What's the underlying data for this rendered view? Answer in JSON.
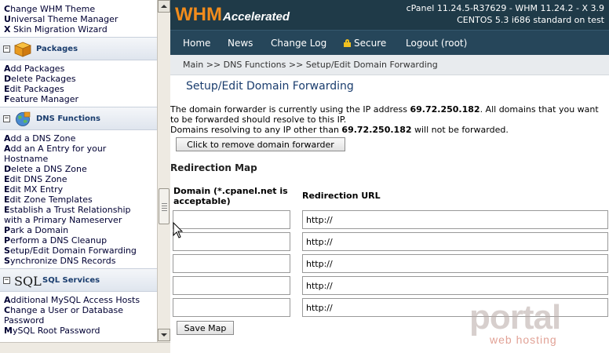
{
  "sidebar": {
    "top_links": [
      {
        "first": "C",
        "rest": "hange WHM Theme"
      },
      {
        "first": "U",
        "rest": "niversal Theme Manager"
      },
      {
        "first": "X",
        "rest": " Skin Migration Wizard"
      }
    ],
    "sections": [
      {
        "title": "Packages",
        "icon": "package-icon",
        "items": [
          {
            "first": "A",
            "rest": "dd Packages"
          },
          {
            "first": "D",
            "rest": "elete Packages"
          },
          {
            "first": "E",
            "rest": "dit Packages"
          },
          {
            "first": "F",
            "rest": "eature Manager"
          }
        ]
      },
      {
        "title": "DNS Functions",
        "icon": "globe-icon",
        "items": [
          {
            "first": "A",
            "rest": "dd a DNS Zone"
          },
          {
            "first": "A",
            "rest": "dd an A Entry for your Hostname"
          },
          {
            "first": "D",
            "rest": "elete a DNS Zone"
          },
          {
            "first": "E",
            "rest": "dit DNS Zone"
          },
          {
            "first": "E",
            "rest": "dit MX Entry"
          },
          {
            "first": "E",
            "rest": "dit Zone Templates"
          },
          {
            "first": "E",
            "rest": "stablish a Trust Relationship with a Primary Nameserver"
          },
          {
            "first": "P",
            "rest": "ark a Domain"
          },
          {
            "first": "P",
            "rest": "erform a DNS Cleanup"
          },
          {
            "first": "S",
            "rest": "etup/Edit Domain Forwarding"
          },
          {
            "first": "S",
            "rest": "ynchronize DNS Records"
          }
        ]
      },
      {
        "title": "SQL Services",
        "icon_text": "SQL",
        "items": [
          {
            "first": "A",
            "rest": "dditional MySQL Access Hosts"
          },
          {
            "first": "C",
            "rest": "hange a User or Database Password"
          },
          {
            "first": "M",
            "rest": "ySQL Root Password"
          }
        ]
      }
    ]
  },
  "header": {
    "logo_main": "WHM",
    "logo_sub": "Accelerated",
    "version_line1": "cPanel 11.24.5-R37629 - WHM 11.24.2 - X 3.9",
    "version_line2": "CENTOS 5.3 i686 standard on test"
  },
  "nav": {
    "home": "Home",
    "news": "News",
    "changelog": "Change Log",
    "secure": "Secure",
    "logout": "Logout (root)"
  },
  "breadcrumb": "Main >> DNS Functions >> Setup/Edit Domain Forwarding",
  "page": {
    "title": "Setup/Edit Domain Forwarding",
    "info_part1": "The domain forwarder is currently using the IP address ",
    "ip": "69.72.250.182",
    "info_part2": ". All domains that you want to be forwarded should resolve to this IP.",
    "info_part3": "Domains resolving to any IP other than ",
    "info_part4": " will not be forwarded.",
    "remove_button": "Click to remove domain forwarder",
    "redirection_title": "Redirection Map",
    "col_domain": "Domain (*.cpanel.net is acceptable)",
    "col_url": "Redirection URL",
    "rows": [
      {
        "domain": "",
        "url": "http://"
      },
      {
        "domain": "",
        "url": "http://"
      },
      {
        "domain": "",
        "url": "http://"
      },
      {
        "domain": "",
        "url": "http://"
      },
      {
        "domain": "",
        "url": "http://"
      }
    ],
    "save_button": "Save Map"
  },
  "watermark": {
    "big": "portal",
    "small": "web hosting"
  },
  "colors": {
    "header_bg": "#1f3a48",
    "nav_bg": "#26465a",
    "logo_orange": "#f28c1c",
    "link_navy": "#000033"
  }
}
